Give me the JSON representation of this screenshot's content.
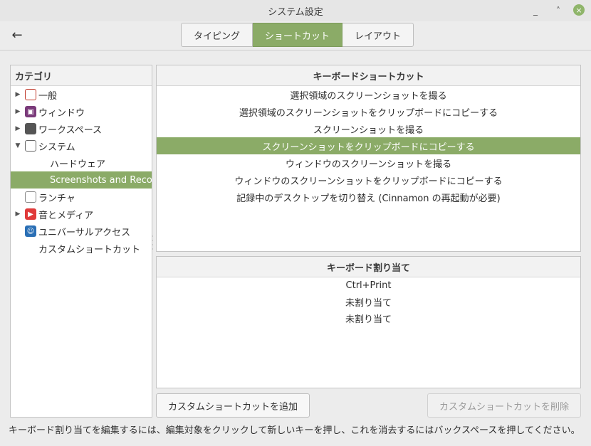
{
  "window": {
    "title": "システム設定",
    "minimize": "_",
    "maximize": "˄",
    "close": "×"
  },
  "header": {
    "back": "←",
    "tabs": [
      {
        "label": "タイピング",
        "active": false
      },
      {
        "label": "ショートカット",
        "active": true
      },
      {
        "label": "レイアウト",
        "active": false
      }
    ]
  },
  "categories": {
    "heading": "カテゴリ",
    "items": [
      {
        "label": "一般",
        "icon": "general-icon",
        "expandable": true
      },
      {
        "label": "ウィンドウ",
        "icon": "window-icon",
        "expandable": true
      },
      {
        "label": "ワークスペース",
        "icon": "workspace-icon",
        "expandable": true
      },
      {
        "label": "システム",
        "icon": "system-icon",
        "expandable": true,
        "expanded": true
      },
      {
        "label": "ハードウェア",
        "sub": true
      },
      {
        "label": "Screenshots and Recording",
        "sub": true,
        "selected": true
      },
      {
        "label": "ランチャ",
        "icon": "launcher-icon",
        "expandable": false
      },
      {
        "label": "音とメディア",
        "icon": "media-icon",
        "expandable": true
      },
      {
        "label": "ユニバーサルアクセス",
        "icon": "accessibility-icon",
        "expandable": false
      },
      {
        "label": "カスタムショートカット",
        "icon": "custom-shortcut-icon",
        "expandable": false
      }
    ]
  },
  "shortcuts": {
    "heading": "キーボードショートカット",
    "items": [
      "選択領域のスクリーンショットを撮る",
      "選択領域のスクリーンショットをクリップボードにコピーする",
      "スクリーンショットを撮る",
      "スクリーンショットをクリップボードにコピーする",
      "ウィンドウのスクリーンショットを撮る",
      "ウィンドウのスクリーンショットをクリップボードにコピーする",
      "記録中のデスクトップを切り替え (Cinnamon の再起動が必要)"
    ],
    "selected_index": 3
  },
  "assignments": {
    "heading": "キーボード割り当て",
    "items": [
      "Ctrl+Print",
      "未割り当て",
      "未割り当て"
    ]
  },
  "buttons": {
    "add": "カスタムショートカットを追加",
    "remove": "カスタムショートカットを削除"
  },
  "hint": "キーボード割り当てを編集するには、編集対象をクリックして新しいキーを押し、これを消去するにはバックスペースを押してください。",
  "colors": {
    "accent": "#8bab67"
  }
}
